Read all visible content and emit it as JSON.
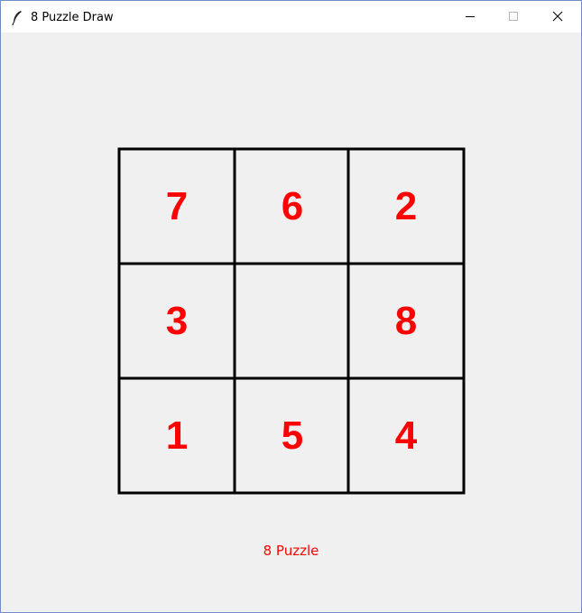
{
  "window": {
    "title": "8 Puzzle Draw",
    "icons": {
      "app": "feather-icon",
      "minimize": "minimize-icon",
      "maximize": "maximize-icon",
      "close": "close-icon"
    }
  },
  "puzzle": {
    "tiles": [
      [
        "7",
        "6",
        "2"
      ],
      [
        "3",
        "",
        "8"
      ],
      [
        "1",
        "5",
        "4"
      ]
    ],
    "tile_color": "#ff0000",
    "line_color": "#000000"
  },
  "caption": {
    "text": "8 Puzzle",
    "color": "#ff0000"
  }
}
